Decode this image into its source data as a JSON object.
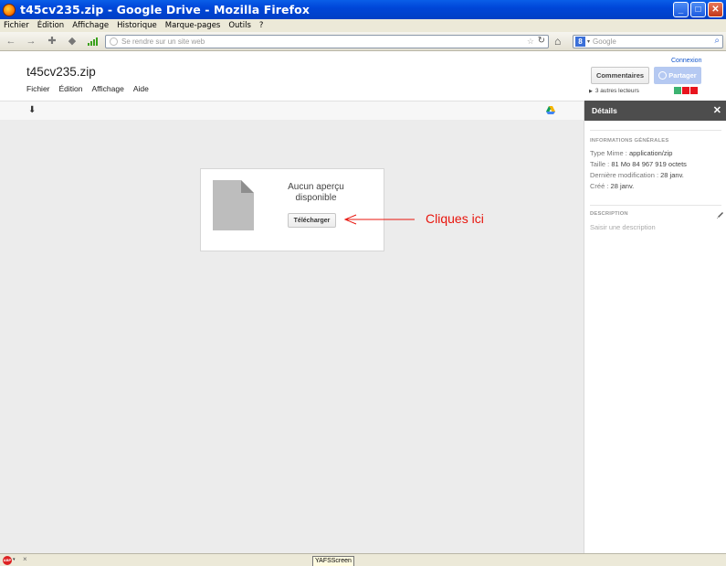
{
  "window": {
    "title": "t45cv235.zip - Google Drive - Mozilla Firefox",
    "minimize": "_",
    "maximize": "□",
    "close": "✕"
  },
  "menubar": {
    "items": [
      "Fichier",
      "Édition",
      "Affichage",
      "Historique",
      "Marque-pages",
      "Outils",
      "?"
    ]
  },
  "navbar": {
    "url_placeholder": "Se rendre sur un site web",
    "search_placeholder": "Google",
    "search_engine_letter": "8"
  },
  "drive": {
    "file_name": "t45cv235.zip",
    "menu": [
      "Fichier",
      "Édition",
      "Affichage",
      "Aide"
    ],
    "connexion": "Connexion",
    "comments_button": "Commentaires",
    "share_button": "Partager",
    "readers_text": "3 autres lecteurs",
    "reader_colors": [
      "#3cb371",
      "#e8141e",
      "#e8141e"
    ]
  },
  "preview": {
    "no_preview": "Aucun aperçu disponible",
    "download_button": "Télécharger",
    "annotation": "Cliques ici",
    "annotation_color": "#e8140c"
  },
  "details": {
    "header": "Détails",
    "general_title": "INFORMATIONS GÉNÉRALES",
    "type_label": "Type Mime :",
    "type_value": "application/zip",
    "size_label": "Taille :",
    "size_value": "81 Mo 84 967 919 octets",
    "modified_label": "Dernière modification :",
    "modified_value": "28 janv.",
    "created_label": "Créé :",
    "created_value": "28 janv.",
    "description_title": "DESCRIPTION",
    "description_placeholder": "Saisir une description"
  },
  "statusbar": {
    "abp_label": "ABP",
    "close": "×",
    "yafs_label": "YAFSScreen"
  }
}
